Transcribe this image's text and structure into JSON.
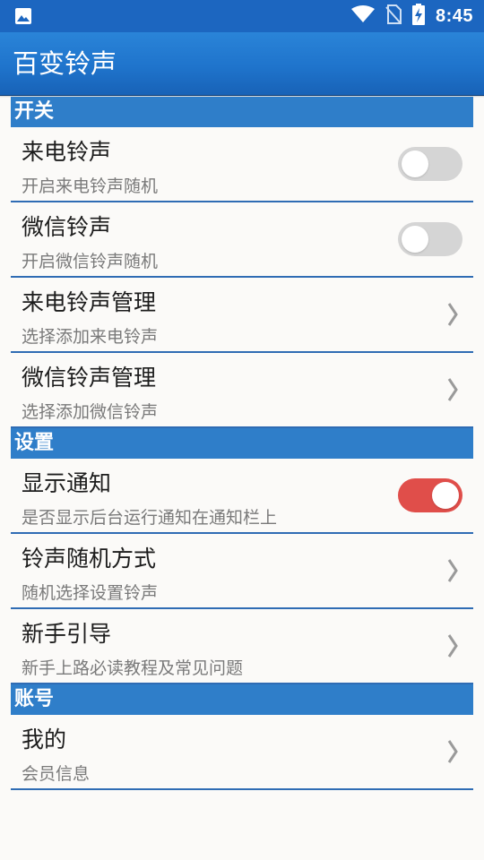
{
  "status_bar": {
    "time": "8:45",
    "icons": [
      "image-icon",
      "wifi-icon",
      "no-sim-icon",
      "battery-charging-icon"
    ]
  },
  "app_bar": {
    "title": "百变铃声",
    "background": "#1f74cc"
  },
  "sections": [
    {
      "header": "开关",
      "items": [
        {
          "title": "来电铃声",
          "subtitle": "开启来电铃声随机",
          "control": "toggle",
          "checked": false
        },
        {
          "title": "微信铃声",
          "subtitle": "开启微信铃声随机",
          "control": "toggle",
          "checked": false
        },
        {
          "title": "来电铃声管理",
          "subtitle": "选择添加来电铃声",
          "control": "chevron"
        },
        {
          "title": "微信铃声管理",
          "subtitle": "选择添加微信铃声",
          "control": "chevron"
        }
      ]
    },
    {
      "header": "设置",
      "items": [
        {
          "title": "显示通知",
          "subtitle": "是否显示后台运行通知在通知栏上",
          "control": "toggle",
          "checked": true
        },
        {
          "title": "铃声随机方式",
          "subtitle": "随机选择设置铃声",
          "control": "chevron"
        },
        {
          "title": "新手引导",
          "subtitle": "新手上路必读教程及常见问题",
          "control": "chevron"
        }
      ]
    },
    {
      "header": "账号",
      "items": [
        {
          "title": "我的",
          "subtitle": "会员信息",
          "control": "chevron"
        }
      ]
    }
  ],
  "colors": {
    "section_header": "#2f7ec9",
    "divider": "#2f6cb4",
    "toggle_on": "#e04e4a",
    "toggle_off": "#d5d5d5"
  }
}
